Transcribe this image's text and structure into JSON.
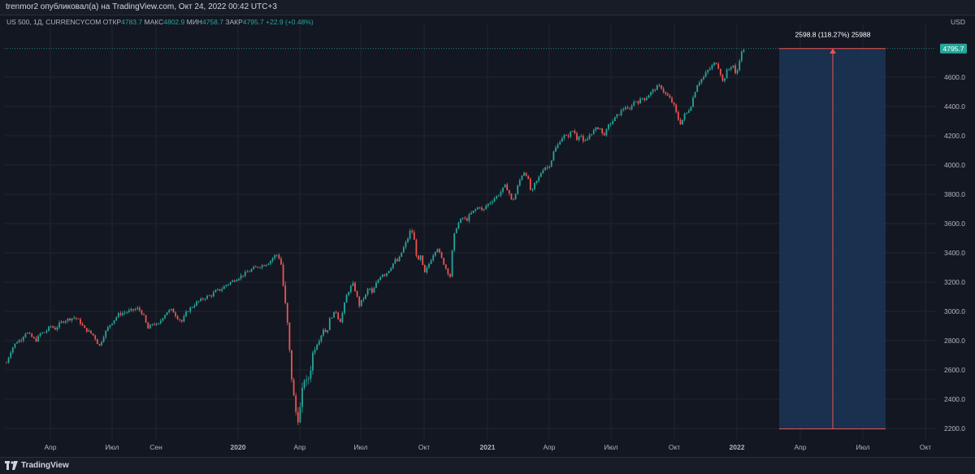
{
  "header": {
    "publish_line": "trenmor2 опубликовал(а) на TradingView.com, Окт 24, 2022 00:42 UTC+3"
  },
  "legend": {
    "symbol": "US 500, 1Д, CURRENCYCOM",
    "open_label": "ОТКР",
    "open": "4783.7",
    "high_label": "МАКС",
    "high": "4802.9",
    "low_label": "МИН",
    "low": "4758.7",
    "close_label": "ЗАКР",
    "close": "4795.7",
    "change": "+22.9 (+0.48%)"
  },
  "currency": "USD",
  "footer": {
    "brand": "TradingView"
  },
  "colors": {
    "up": "#26a69a",
    "down": "#ef5350",
    "background": "#131722",
    "grid": "#1f2430",
    "measure_fill": "#1c3a5e"
  },
  "chart_data": {
    "type": "candlestick",
    "y_ticks": [
      "2200.0",
      "2400.0",
      "2600.0",
      "2800.0",
      "3000.0",
      "3200.0",
      "3400.0",
      "3600.0",
      "3800.0",
      "4000.0",
      "4200.0",
      "4400.0",
      "4600.0"
    ],
    "ylim": [
      2120,
      4880
    ],
    "x_ticks": [
      "Апр",
      "Июл",
      "Сен",
      "2020",
      "Апр",
      "Июл",
      "Окт",
      "2021",
      "Апр",
      "Июл",
      "Окт",
      "2022",
      "Апр",
      "Июл",
      "Окт"
    ],
    "last_price": "4795.7",
    "measure_label": "2598.8 (118.27%) 25988",
    "measure_range": [
      2197,
      4796
    ],
    "price_path": [
      [
        0,
        2650
      ],
      [
        6,
        2740
      ],
      [
        12,
        2790
      ],
      [
        18,
        2810
      ],
      [
        24,
        2860
      ],
      [
        30,
        2830
      ],
      [
        36,
        2800
      ],
      [
        42,
        2850
      ],
      [
        48,
        2860
      ],
      [
        54,
        2900
      ],
      [
        60,
        2880
      ],
      [
        66,
        2920
      ],
      [
        72,
        2940
      ],
      [
        78,
        2950
      ],
      [
        84,
        2960
      ],
      [
        90,
        2930
      ],
      [
        96,
        2880
      ],
      [
        102,
        2860
      ],
      [
        108,
        2830
      ],
      [
        114,
        2760
      ],
      [
        120,
        2840
      ],
      [
        126,
        2900
      ],
      [
        132,
        2940
      ],
      [
        138,
        2980
      ],
      [
        144,
        2990
      ],
      [
        150,
        3000
      ],
      [
        156,
        3010
      ],
      [
        162,
        3020
      ],
      [
        168,
        2980
      ],
      [
        174,
        2880
      ],
      [
        180,
        2920
      ],
      [
        186,
        2900
      ],
      [
        192,
        2960
      ],
      [
        198,
        3000
      ],
      [
        204,
        3010
      ],
      [
        210,
        2960
      ],
      [
        216,
        2930
      ],
      [
        222,
        3000
      ],
      [
        228,
        3030
      ],
      [
        234,
        3060
      ],
      [
        240,
        3080
      ],
      [
        246,
        3100
      ],
      [
        252,
        3110
      ],
      [
        258,
        3140
      ],
      [
        264,
        3150
      ],
      [
        270,
        3180
      ],
      [
        276,
        3200
      ],
      [
        282,
        3220
      ],
      [
        288,
        3240
      ],
      [
        294,
        3260
      ],
      [
        300,
        3280
      ],
      [
        306,
        3300
      ],
      [
        312,
        3310
      ],
      [
        318,
        3320
      ],
      [
        324,
        3340
      ],
      [
        330,
        3380
      ],
      [
        334,
        3390
      ],
      [
        338,
        3320
      ],
      [
        342,
        3100
      ],
      [
        346,
        2900
      ],
      [
        350,
        2600
      ],
      [
        354,
        2390
      ],
      [
        358,
        2250
      ],
      [
        362,
        2350
      ],
      [
        366,
        2550
      ],
      [
        370,
        2500
      ],
      [
        374,
        2600
      ],
      [
        378,
        2750
      ],
      [
        382,
        2780
      ],
      [
        386,
        2820
      ],
      [
        390,
        2880
      ],
      [
        394,
        2850
      ],
      [
        398,
        2950
      ],
      [
        402,
        2980
      ],
      [
        406,
        3000
      ],
      [
        410,
        2920
      ],
      [
        414,
        3000
      ],
      [
        418,
        3100
      ],
      [
        422,
        3150
      ],
      [
        426,
        3190
      ],
      [
        430,
        3130
      ],
      [
        434,
        3040
      ],
      [
        438,
        3080
      ],
      [
        442,
        3110
      ],
      [
        446,
        3170
      ],
      [
        450,
        3120
      ],
      [
        454,
        3180
      ],
      [
        458,
        3220
      ],
      [
        462,
        3260
      ],
      [
        466,
        3250
      ],
      [
        470,
        3280
      ],
      [
        474,
        3310
      ],
      [
        478,
        3350
      ],
      [
        482,
        3340
      ],
      [
        486,
        3400
      ],
      [
        490,
        3450
      ],
      [
        494,
        3500
      ],
      [
        498,
        3570
      ],
      [
        502,
        3480
      ],
      [
        506,
        3330
      ],
      [
        510,
        3380
      ],
      [
        514,
        3250
      ],
      [
        518,
        3300
      ],
      [
        522,
        3350
      ],
      [
        526,
        3400
      ],
      [
        530,
        3440
      ],
      [
        534,
        3380
      ],
      [
        538,
        3330
      ],
      [
        542,
        3280
      ],
      [
        546,
        3240
      ],
      [
        550,
        3500
      ],
      [
        554,
        3580
      ],
      [
        558,
        3620
      ],
      [
        562,
        3640
      ],
      [
        566,
        3620
      ],
      [
        570,
        3660
      ],
      [
        574,
        3680
      ],
      [
        578,
        3700
      ],
      [
        582,
        3720
      ],
      [
        586,
        3680
      ],
      [
        590,
        3720
      ],
      [
        594,
        3740
      ],
      [
        598,
        3760
      ],
      [
        602,
        3780
      ],
      [
        606,
        3800
      ],
      [
        610,
        3830
      ],
      [
        614,
        3860
      ],
      [
        618,
        3820
      ],
      [
        622,
        3750
      ],
      [
        626,
        3790
      ],
      [
        630,
        3870
      ],
      [
        634,
        3930
      ],
      [
        638,
        3960
      ],
      [
        642,
        3900
      ],
      [
        646,
        3800
      ],
      [
        650,
        3870
      ],
      [
        654,
        3900
      ],
      [
        658,
        3950
      ],
      [
        662,
        3990
      ],
      [
        666,
        3980
      ],
      [
        670,
        4020
      ],
      [
        674,
        4100
      ],
      [
        678,
        4130
      ],
      [
        682,
        4180
      ],
      [
        686,
        4200
      ],
      [
        690,
        4190
      ],
      [
        694,
        4220
      ],
      [
        698,
        4240
      ],
      [
        702,
        4180
      ],
      [
        706,
        4220
      ],
      [
        710,
        4150
      ],
      [
        714,
        4170
      ],
      [
        718,
        4210
      ],
      [
        722,
        4230
      ],
      [
        726,
        4250
      ],
      [
        730,
        4260
      ],
      [
        734,
        4200
      ],
      [
        738,
        4230
      ],
      [
        742,
        4280
      ],
      [
        746,
        4300
      ],
      [
        750,
        4330
      ],
      [
        754,
        4350
      ],
      [
        758,
        4380
      ],
      [
        762,
        4400
      ],
      [
        766,
        4360
      ],
      [
        770,
        4420
      ],
      [
        774,
        4440
      ],
      [
        778,
        4430
      ],
      [
        782,
        4460
      ],
      [
        786,
        4450
      ],
      [
        790,
        4480
      ],
      [
        794,
        4500
      ],
      [
        798,
        4520
      ],
      [
        802,
        4540
      ],
      [
        806,
        4530
      ],
      [
        810,
        4490
      ],
      [
        814,
        4470
      ],
      [
        818,
        4440
      ],
      [
        822,
        4400
      ],
      [
        826,
        4320
      ],
      [
        830,
        4280
      ],
      [
        834,
        4340
      ],
      [
        838,
        4360
      ],
      [
        842,
        4400
      ],
      [
        846,
        4480
      ],
      [
        850,
        4550
      ],
      [
        854,
        4580
      ],
      [
        858,
        4600
      ],
      [
        862,
        4640
      ],
      [
        866,
        4660
      ],
      [
        870,
        4690
      ],
      [
        874,
        4700
      ],
      [
        878,
        4640
      ],
      [
        882,
        4560
      ],
      [
        886,
        4640
      ],
      [
        890,
        4660
      ],
      [
        894,
        4690
      ],
      [
        898,
        4600
      ],
      [
        902,
        4720
      ],
      [
        906,
        4790
      ],
      [
        909,
        4796
      ]
    ]
  }
}
